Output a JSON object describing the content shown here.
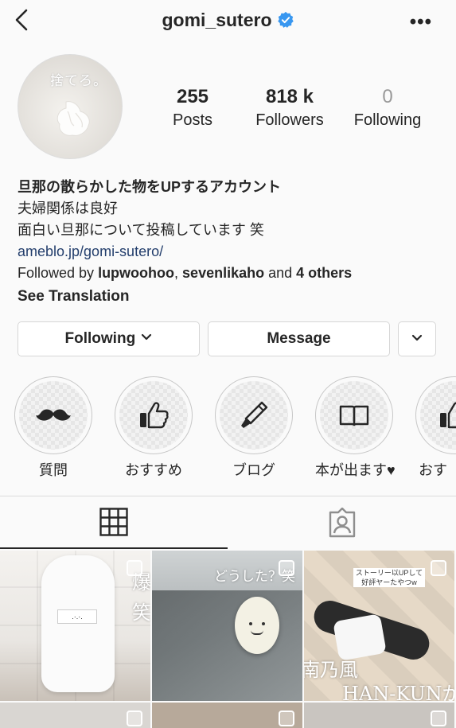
{
  "header": {
    "username": "gomi_sutero"
  },
  "avatar": {
    "text": "捨てろ。"
  },
  "stats": [
    {
      "value": "255",
      "label": "Posts"
    },
    {
      "value": "818 k",
      "label": "Followers"
    },
    {
      "value": "0",
      "label": "Following"
    }
  ],
  "bio": {
    "title": "旦那の散らかした物をUPするアカウント",
    "line2": "夫婦関係は良好",
    "line3": "面白い旦那について投稿しています 笑",
    "link": "ameblo.jp/gomi-sutero/",
    "followed_prefix": "Followed by ",
    "followed_user1": "lupwoohoo",
    "followed_sep": ", ",
    "followed_user2": "sevenlikaho",
    "followed_and": " and ",
    "followed_others": "4 others",
    "see_translation": "See Translation"
  },
  "buttons": {
    "following": "Following",
    "message": "Message"
  },
  "highlights": [
    {
      "label": "質問",
      "icon": "mustache-icon"
    },
    {
      "label": "おすすめ",
      "icon": "thumbs-up-icon"
    },
    {
      "label": "ブログ",
      "icon": "pen-icon"
    },
    {
      "label": "本が出ます♥",
      "icon": "book-icon"
    },
    {
      "label": "おす",
      "icon": "thumbs-up-icon"
    }
  ],
  "posts": {
    "tile1_text": "爆",
    "tile1_text2": "笑",
    "tile2_text": "どうした？笑",
    "tile3_caption": "ストーリー以UPして",
    "tile3_caption2": "好評ヤーたやつw",
    "tile3_text1": "南乃風",
    "tile3_text2": "HAN-KUNが"
  }
}
